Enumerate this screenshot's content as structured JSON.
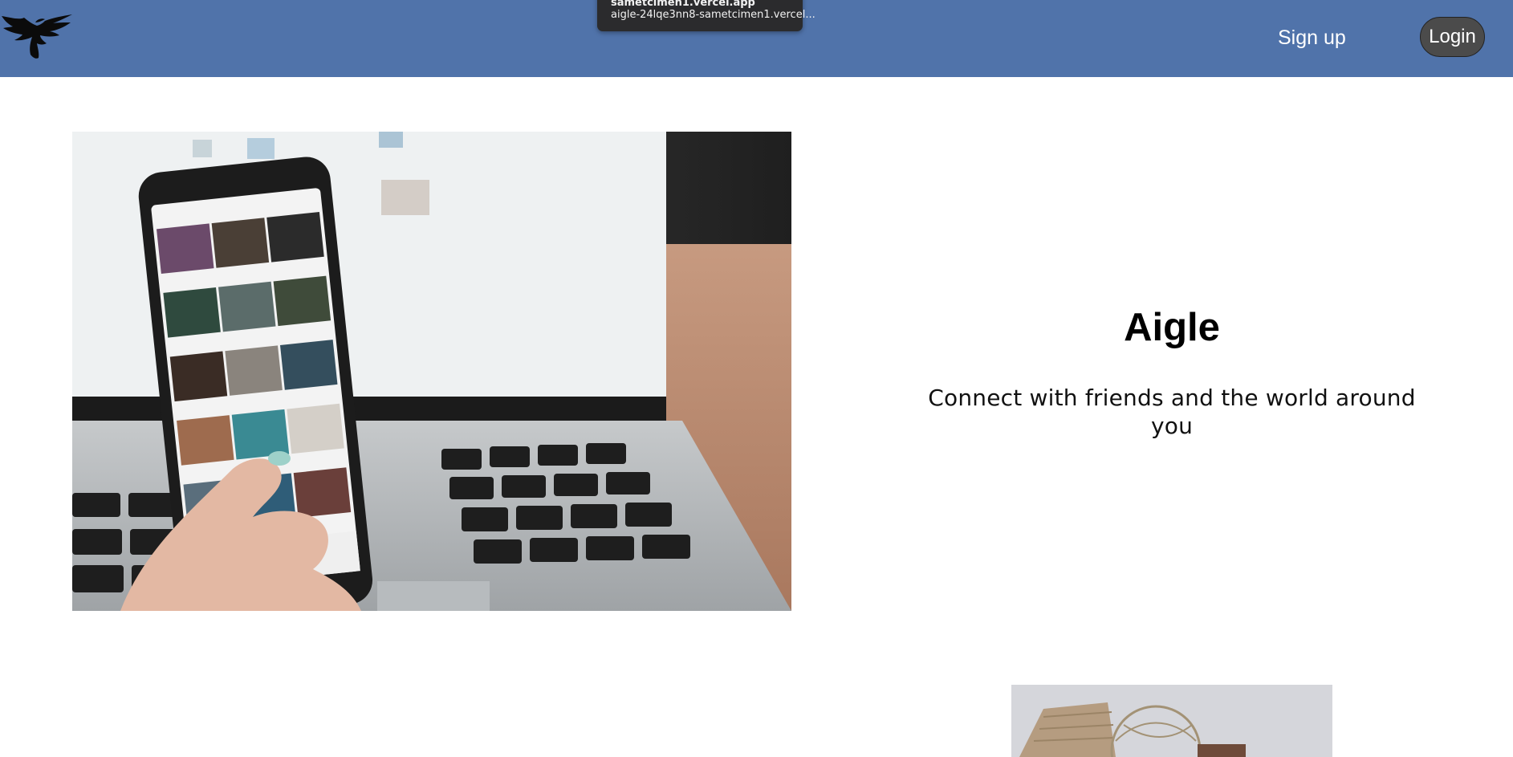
{
  "header": {
    "logo_alt": "eagle-logo",
    "signup_label": "Sign up",
    "login_label": "Login",
    "bg_color": "#5073aa"
  },
  "tooltip": {
    "line1": "sametcimen1.vercel.app",
    "line2": "aigle-24lqe3nn8-sametcimen1.vercel..."
  },
  "hero": {
    "title": "Aigle",
    "tagline": "Connect with friends and the world around you",
    "image_alt": "hand holding phone with photo feed in front of laptop"
  },
  "second_section": {
    "image_alt": "wicker basket and wire globe photo"
  }
}
